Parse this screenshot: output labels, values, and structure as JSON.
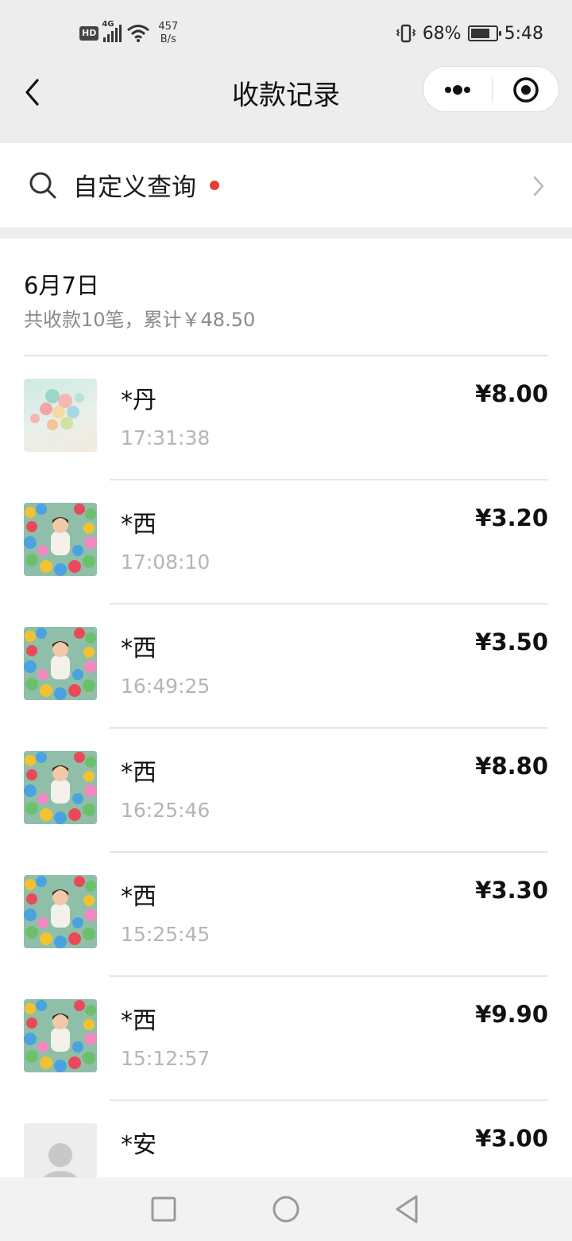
{
  "status_bar": {
    "hd": "HD",
    "network": "4G",
    "net_speed_value": "457",
    "net_speed_unit": "B/s",
    "battery": "68%",
    "time": "5:48"
  },
  "nav": {
    "title": "收款记录"
  },
  "search": {
    "label": "自定义查询"
  },
  "group": {
    "date": "6月7日",
    "summary": "共收款10笔，累计￥48.50"
  },
  "records": [
    {
      "name": "*丹",
      "time": "17:31:38",
      "amount": "¥8.00",
      "avatar": "balloon-photo"
    },
    {
      "name": "*西",
      "time": "17:08:10",
      "amount": "¥3.20",
      "avatar": "ball-pit-photo"
    },
    {
      "name": "*西",
      "time": "16:49:25",
      "amount": "¥3.50",
      "avatar": "ball-pit-photo"
    },
    {
      "name": "*西",
      "time": "16:25:46",
      "amount": "¥8.80",
      "avatar": "ball-pit-photo"
    },
    {
      "name": "*西",
      "time": "15:25:45",
      "amount": "¥3.30",
      "avatar": "ball-pit-photo"
    },
    {
      "name": "*西",
      "time": "15:12:57",
      "amount": "¥9.90",
      "avatar": "ball-pit-photo"
    },
    {
      "name": "*安",
      "time": "",
      "amount": "¥3.00",
      "avatar": "default-avatar"
    }
  ],
  "colors": {
    "page_bg": "#ededed",
    "card_bg": "#ffffff",
    "notification_dot": "#e83b34",
    "secondary_text": "#8a8a8a",
    "time_text": "#b5b5b5"
  }
}
